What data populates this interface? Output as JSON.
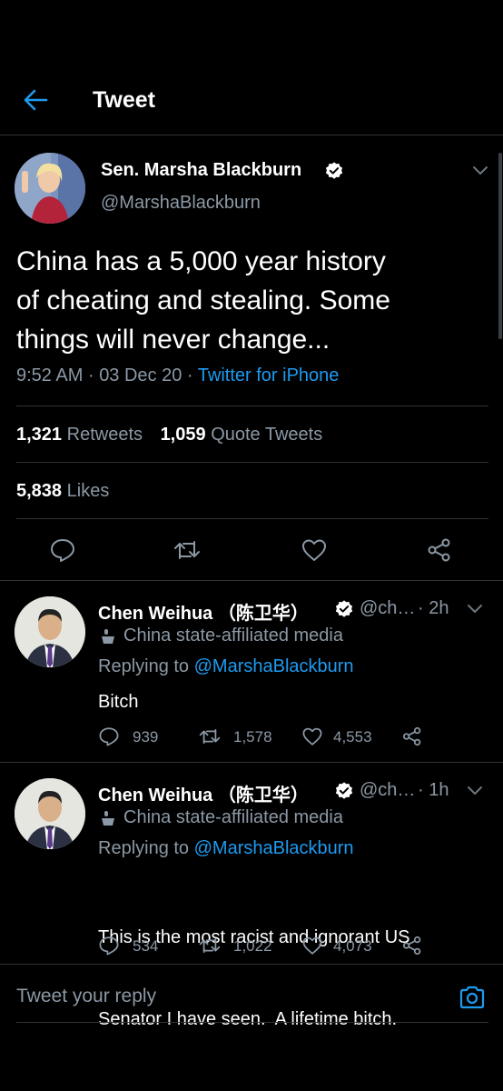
{
  "header": {
    "title": "Tweet"
  },
  "tweet": {
    "author_name": "Sen. Marsha Blackburn",
    "author_handle": "@MarshaBlackburn",
    "text_line1": "China has a 5,000 year history",
    "text_line2": "of cheating and stealing. Some",
    "text_line3": "things will never change...",
    "time": "9:52 AM",
    "separator": "·",
    "date": "03 Dec 20",
    "client": "Twitter for iPhone",
    "retweets_count": "1,321",
    "retweets_label": "Retweets",
    "quotes_count": "1,059",
    "quotes_label": "Quote Tweets",
    "likes_count": "5,838",
    "likes_label": "Likes"
  },
  "replies": [
    {
      "name": "Chen Weihua （陈卫华）",
      "handle": "@ch…",
      "time": "· 2h",
      "affiliation": "China state-affiliated media",
      "replying_prefix": "Replying to",
      "replying_to": "@MarshaBlackburn",
      "text_line1": "Bitch",
      "text_line2": "",
      "comments": "939",
      "retweets": "1,578",
      "likes": "4,553"
    },
    {
      "name": "Chen Weihua （陈卫华）",
      "handle": "@ch…",
      "time": "· 1h",
      "affiliation": "China state-affiliated media",
      "replying_prefix": "Replying to",
      "replying_to": "@MarshaBlackburn",
      "text_line1": "This is the most racist and ignorant US",
      "text_line2": "Senator I have seen.  A lifetime bitch.",
      "comments": "534",
      "retweets": "1,022",
      "likes": "4,073"
    }
  ],
  "composer": {
    "placeholder": "Tweet your reply"
  },
  "icons": {
    "back": "arrow-left-icon",
    "verified": "verified-badge-icon",
    "chevron": "chevron-down-icon",
    "reply": "comment-icon",
    "retweet": "retweet-icon",
    "like": "heart-icon",
    "share": "share-icon",
    "state_media": "podium-icon",
    "camera": "camera-icon"
  },
  "colors": {
    "background": "#000000",
    "accent": "#1d9bf0",
    "muted": "#8b98a5",
    "divider": "#2f3336"
  }
}
